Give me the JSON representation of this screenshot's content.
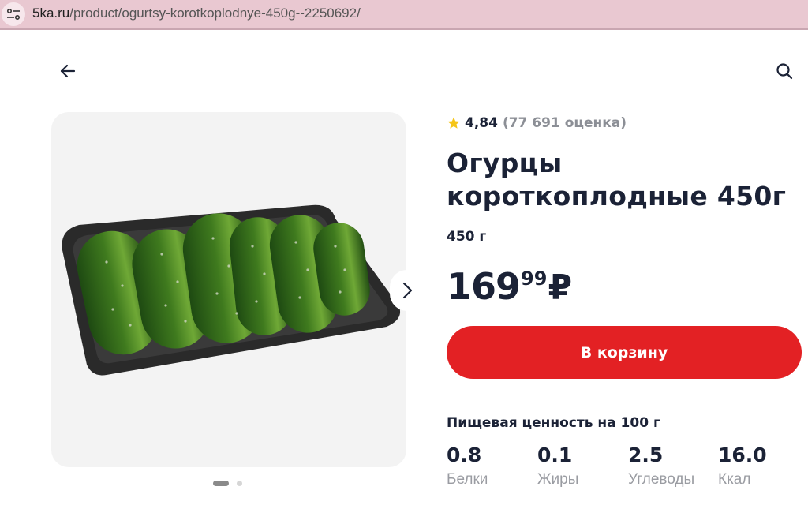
{
  "browser": {
    "url_domain": "5ka.ru",
    "url_path": "/product/ogurtsy-korotkoplodnye-450g--2250692/",
    "site_settings_icon": "tune-icon"
  },
  "header": {
    "back_icon": "arrow-left-icon",
    "search_icon": "search-icon"
  },
  "gallery": {
    "next_icon": "chevron-right-icon",
    "slides_total": 2,
    "active_slide": 1
  },
  "product": {
    "rating_icon": "star-icon",
    "rating_value": "4,84",
    "rating_count": "(77 691 оценка)",
    "title": "Огурцы короткоплодные 450г",
    "weight": "450 г",
    "price_rub": "169",
    "price_kop": "99",
    "currency": "₽",
    "add_to_cart_label": "В корзину"
  },
  "nutrition": {
    "title": "Пищевая ценность на 100 г",
    "items": [
      {
        "value": "0.8",
        "label": "Белки"
      },
      {
        "value": "0.1",
        "label": "Жиры"
      },
      {
        "value": "2.5",
        "label": "Углеводы"
      },
      {
        "value": "16.0",
        "label": "Ккал"
      }
    ]
  },
  "colors": {
    "accent": "#e32124",
    "text": "#1b2236",
    "muted": "#8c8f96",
    "star": "#f5c518",
    "url_bar": "#e9c8d1"
  }
}
